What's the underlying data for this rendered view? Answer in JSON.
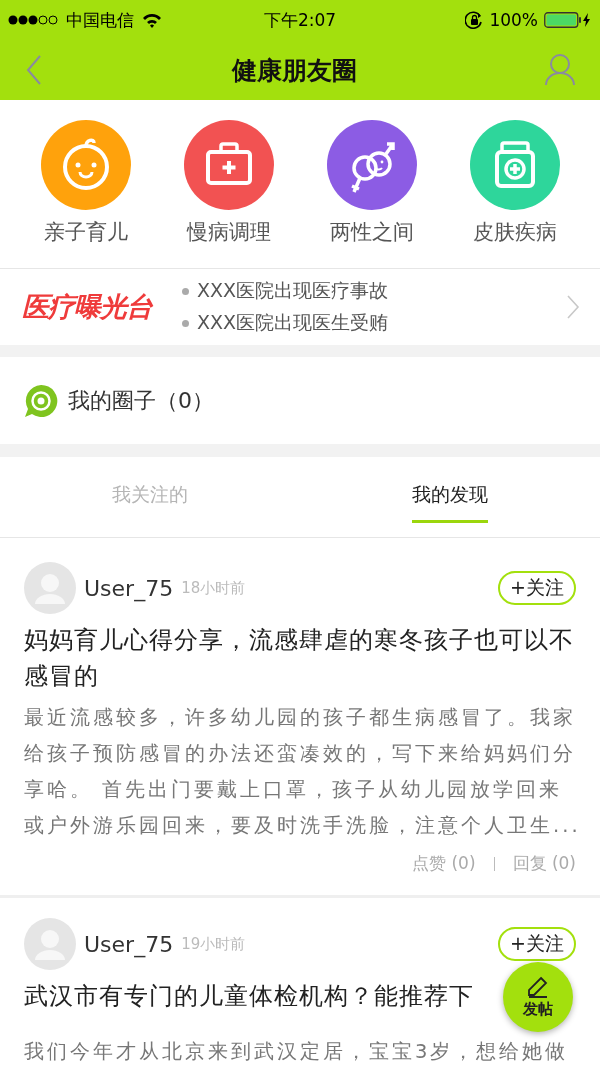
{
  "status_bar": {
    "carrier": "中国电信",
    "time": "下午2:07",
    "battery": "100%"
  },
  "nav": {
    "title": "健康朋友圈"
  },
  "categories": [
    {
      "label": "亲子育儿",
      "kind": "baby",
      "color": "#ffa20c"
    },
    {
      "label": "慢病调理",
      "kind": "medkit",
      "color": "#f25252"
    },
    {
      "label": "两性之间",
      "kind": "gender",
      "color": "#8c5ce4"
    },
    {
      "label": "皮肤疾病",
      "kind": "bottle",
      "color": "#2ed69b"
    }
  ],
  "exposure": {
    "logo": "医疗曝光台",
    "headlines": [
      "XXX医院出现医疗事故",
      "XXX医院出现医生受贿"
    ]
  },
  "my_circles": {
    "label": "我的圈子（0）"
  },
  "tabs": [
    {
      "label": "我关注的",
      "selected": false
    },
    {
      "label": "我的发现",
      "selected": true
    }
  ],
  "posts": [
    {
      "user": "User_75",
      "time": "18小时前",
      "follow": "+关注",
      "title": "妈妈育儿心得分享，流感肆虐的寒冬孩子也可以不感冒的",
      "body": "最近流感较多，许多幼儿园的孩子都生病感冒了。我家给孩子预防感冒的办法还蛮凑效的，写下来给妈妈们分享哈。 首先出门要戴上口罩，孩子从幼儿园放学回来或户外游乐园回来，要及时洗手洗脸，注意个人卫生...",
      "likes": "点赞 (0)",
      "replies": "回复 (0)"
    },
    {
      "user": "User_75",
      "time": "19小时前",
      "follow": "+关注",
      "title": "武汉市有专门的儿童体检机构？能推荐下",
      "body": "我们今年才从北京来到武汉定居，宝宝3岁，想给她做"
    }
  ],
  "fab": {
    "label": "发帖"
  }
}
